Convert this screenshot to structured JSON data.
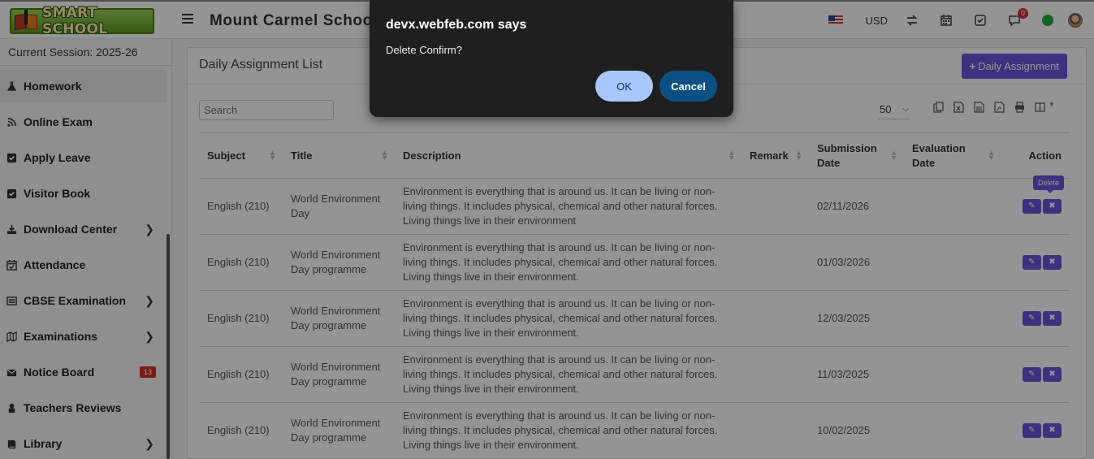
{
  "header": {
    "logo_text": "SMART SCHOOL",
    "school_name": "Mount Carmel School",
    "currency": "USD",
    "chat_badge": "0"
  },
  "sidebar": {
    "session": "Current Session: 2025-26",
    "items": [
      {
        "label": "Homework",
        "icon": "flask-icon",
        "active": true
      },
      {
        "label": "Online Exam",
        "icon": "rss-icon"
      },
      {
        "label": "Apply Leave",
        "icon": "check-square-icon"
      },
      {
        "label": "Visitor Book",
        "icon": "check-square-icon"
      },
      {
        "label": "Download Center",
        "icon": "download-icon",
        "chevron": true
      },
      {
        "label": "Attendance",
        "icon": "calendar-check-icon"
      },
      {
        "label": "CBSE Examination",
        "icon": "newspaper-icon",
        "chevron": true
      },
      {
        "label": "Examinations",
        "icon": "map-icon",
        "chevron": true
      },
      {
        "label": "Notice Board",
        "icon": "envelope-icon",
        "badge": "13"
      },
      {
        "label": "Teachers Reviews",
        "icon": "user-lock-icon"
      },
      {
        "label": "Library",
        "icon": "book-icon",
        "chevron": true
      }
    ]
  },
  "main": {
    "title": "Daily Assignment List",
    "add_button": "Daily Assignment",
    "search_placeholder": "Search",
    "page_length": "50",
    "tooltip": "Delete",
    "columns": [
      "Subject",
      "Title",
      "Description",
      "Remark",
      "Submission Date",
      "Evaluation Date",
      "Action"
    ],
    "rows": [
      {
        "subject": "English (210)",
        "title": "World Environment Day",
        "description": "Environment is everything that is around us. It can be living or non-living things. It includes physical, chemical and other natural forces. Living things live in their environment",
        "remark": "",
        "submission": "02/11/2026",
        "evaluation": ""
      },
      {
        "subject": "English (210)",
        "title": "World Environment Day programme",
        "description": "Environment is everything that is around us. It can be living or non-living things. It includes physical, chemical and other natural forces. Living things live in their environment.",
        "remark": "",
        "submission": "01/03/2026",
        "evaluation": ""
      },
      {
        "subject": "English (210)",
        "title": "World Environment Day programme",
        "description": "Environment is everything that is around us. It can be living or non-living things. It includes physical, chemical and other natural forces. Living things live in their environment.",
        "remark": "",
        "submission": "12/03/2025",
        "evaluation": ""
      },
      {
        "subject": "English (210)",
        "title": "World Environment Day programme",
        "description": "Environment is everything that is around us. It can be living or non-living things. It includes physical, chemical and other natural forces. Living things live in their environment.",
        "remark": "",
        "submission": "11/03/2025",
        "evaluation": ""
      },
      {
        "subject": "English (210)",
        "title": "World Environment Day programme",
        "description": "Environment is everything that is around us. It can be living or non-living things. It includes physical, chemical and other natural forces. Living things live in their environment.",
        "remark": "",
        "submission": "10/02/2025",
        "evaluation": ""
      }
    ]
  },
  "dialog": {
    "title": "devx.webfeb.com says",
    "message": "Delete Confirm?",
    "ok": "OK",
    "cancel": "Cancel"
  },
  "colors": {
    "accent": "#6658dd",
    "dialog_bg": "#1f1f1f",
    "ok_bg": "#a8c7fa",
    "cancel_bg": "#0b5085",
    "badge": "#d32f2f"
  }
}
